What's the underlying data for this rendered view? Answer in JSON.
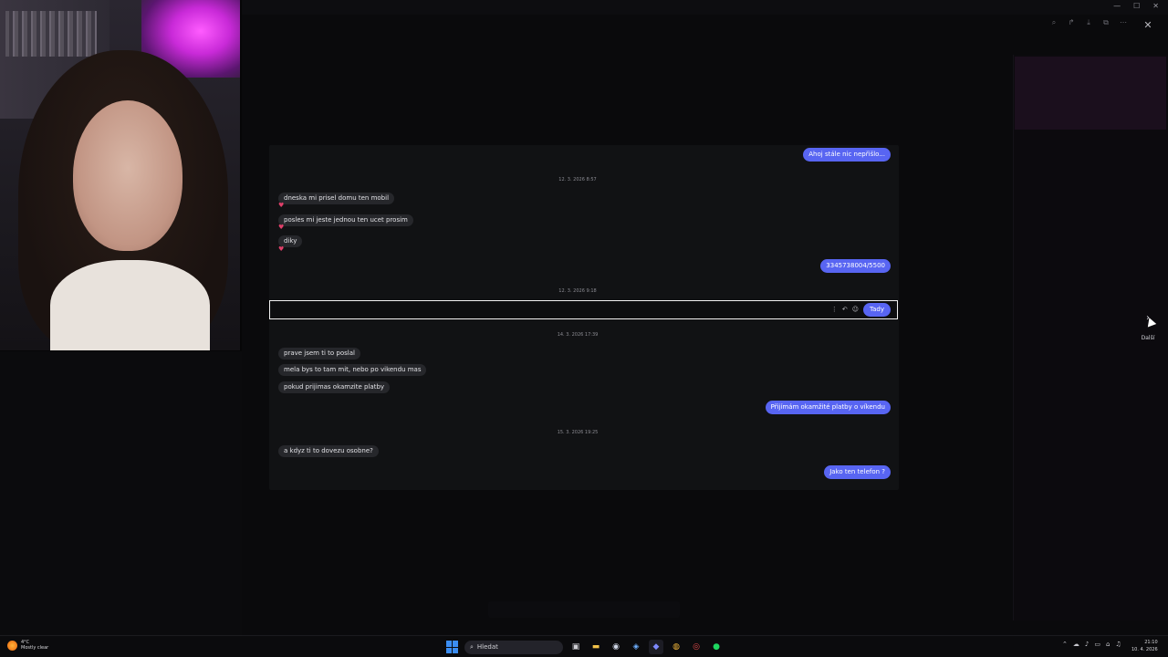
{
  "chat": {
    "outgoing_1": "Ahoj stále nic nepřišlo...",
    "date_1": "12. 3. 2026 8:57",
    "incoming_1": "dneska mi prisel domu ten mobil",
    "incoming_2": "posles mi jeste jednou ten ucet prosim",
    "incoming_3": "diky",
    "outgoing_2": "3345738004/5500",
    "date_2": "12. 3. 2026 9:18",
    "highlighted_message": "Tady",
    "date_3": "14. 3. 2026 17:39",
    "incoming_4": "prave jsem ti to poslal",
    "incoming_5": "mela bys to tam mit, nebo po vikendu mas",
    "incoming_6": "pokud prijimas okamzite platby",
    "outgoing_3": "Přijímám okamžité platby o víkendu",
    "date_4": "15. 3. 2026 19:25",
    "incoming_7": "a kdyz ti to dovezu osobne?",
    "outgoing_4": "Jako ten telefon ?",
    "reaction_icon": "heart-icon"
  },
  "viewer": {
    "next_label": "Další"
  },
  "taskbar": {
    "weather_temp": "4°C",
    "weather_text": "Mostly clear",
    "search_placeholder": "Hledat",
    "time": "21:10",
    "date": "10. 4. 2026"
  }
}
